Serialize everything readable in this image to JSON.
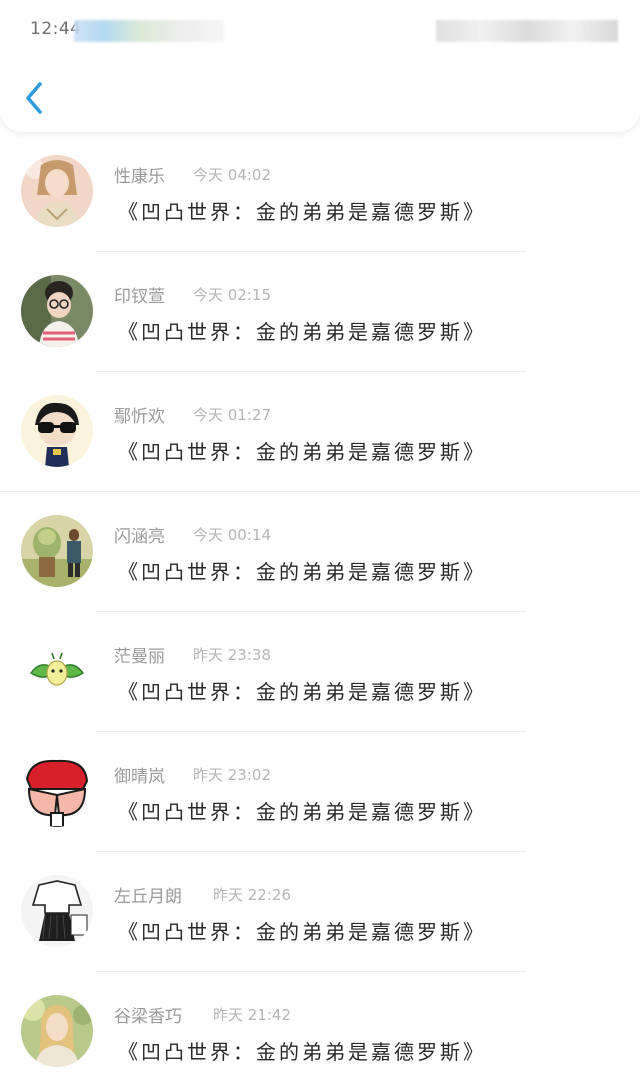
{
  "status_bar": {
    "time": "12:44"
  },
  "header": {
    "back_icon": "chevron-left-icon",
    "accent_color": "#2f9ae0"
  },
  "messages": [
    {
      "name": "性康乐",
      "time": "今天 04:02",
      "text": "《凹凸世界：金的弟弟是嘉德罗斯》",
      "avatar": "girl-portrait"
    },
    {
      "name": "印钗萱",
      "time": "今天 02:15",
      "text": "《凹凸世界：金的弟弟是嘉德罗斯》",
      "avatar": "boy-with-glasses"
    },
    {
      "name": "鄢忻欢",
      "time": "今天 01:27",
      "text": "《凹凸世界：金的弟弟是嘉德罗斯》",
      "avatar": "cartoon-sunglasses"
    },
    {
      "name": "闪涵亮",
      "time": "今天 00:14",
      "text": "《凹凸世界：金的弟弟是嘉德罗斯》",
      "avatar": "illustration-ogre"
    },
    {
      "name": "茫曼丽",
      "time": "昨天 23:38",
      "text": "《凹凸世界：金的弟弟是嘉德罗斯》",
      "avatar": "green-leaf-creature"
    },
    {
      "name": "御晴岚",
      "time": "昨天 23:02",
      "text": "《凹凸世界：金的弟弟是嘉德罗斯》",
      "avatar": "cartoon-red-cap"
    },
    {
      "name": "左丘月朗",
      "time": "昨天 22:26",
      "text": "《凹凸世界：金的弟弟是嘉德罗斯》",
      "avatar": "outfit-photo"
    },
    {
      "name": "谷梁香巧",
      "time": "昨天 21:42",
      "text": "《凹凸世界：金的弟弟是嘉德罗斯》",
      "avatar": "girl-outdoor"
    }
  ]
}
